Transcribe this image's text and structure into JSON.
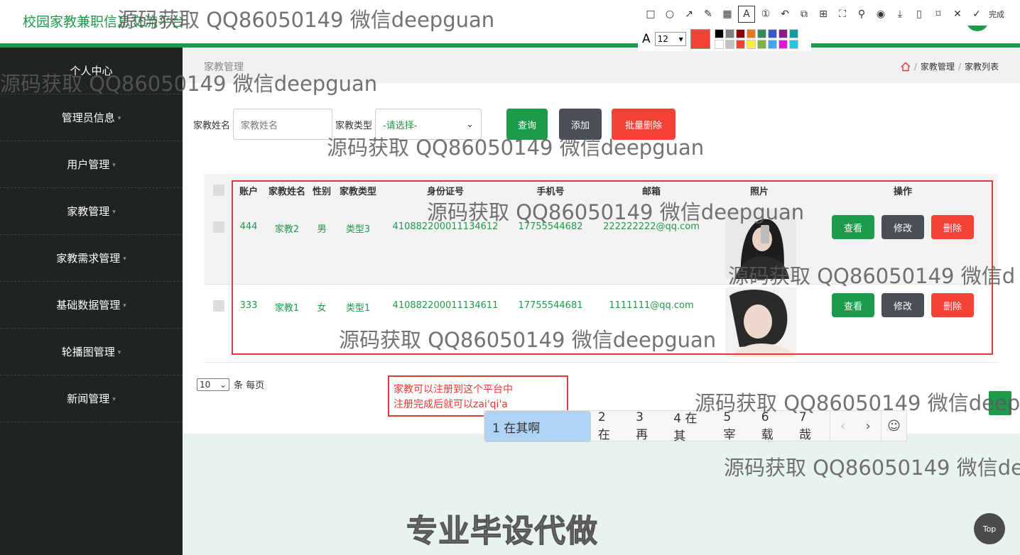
{
  "app": {
    "title": "校园家教兼职信息交流平台"
  },
  "sidebar": {
    "items": [
      {
        "label": "个人中心"
      },
      {
        "label": "管理员信息"
      },
      {
        "label": "用户管理"
      },
      {
        "label": "家教管理"
      },
      {
        "label": "家教需求管理"
      },
      {
        "label": "基础数据管理"
      },
      {
        "label": "轮播图管理"
      },
      {
        "label": "新闻管理"
      }
    ]
  },
  "page": {
    "title": "家教管理",
    "breadcrumb": [
      "家教管理",
      "家教列表"
    ]
  },
  "search": {
    "name_label": "家教姓名",
    "name_placeholder": "家教姓名",
    "type_label": "家教类型",
    "type_selected": "-请选择-",
    "query_button": "查询",
    "add_button": "添加",
    "batch_delete_button": "批量删除"
  },
  "table": {
    "headers": [
      "账户",
      "家教姓名",
      "性别",
      "家教类型",
      "身份证号",
      "手机号",
      "邮箱",
      "照片",
      "操作"
    ],
    "rows": [
      {
        "account": "444",
        "name": "家教2",
        "gender": "男",
        "type": "类型3",
        "id_number": "410882200011134612",
        "phone": "17755544682",
        "email": "222222222@qq.com"
      },
      {
        "account": "333",
        "name": "家教1",
        "gender": "女",
        "type": "类型1",
        "id_number": "410882200011134611",
        "phone": "17755544681",
        "email": "1111111@qq.com"
      }
    ],
    "actions": {
      "view": "查看",
      "edit": "修改",
      "delete": "删除"
    }
  },
  "pagination": {
    "page_size": "10",
    "per_page_label": "条 每页"
  },
  "note": {
    "line1": "家教可以注册到这个平台中",
    "line2": "注册完成后就可以zai'qi'a"
  },
  "ime": {
    "candidates": [
      "1 在其啊",
      "2 在",
      "3 再",
      "4 在其",
      "5 宰",
      "6 载",
      "7 哉"
    ],
    "prev": "‹",
    "next": "›",
    "emoji": "☺"
  },
  "toolbar": {
    "done_label": "完成",
    "font_size": "12",
    "current_color": "#f44336",
    "palette": [
      "#000000",
      "#808080",
      "#8b0000",
      "#e87722",
      "#2e8b57",
      "#3558c8",
      "#8b1a8b",
      "#1a9b9b",
      "#ffffff",
      "#c0c0c0",
      "#f44336",
      "#ffeb3b",
      "#7cb342",
      "#42a5f5",
      "#d81bd8",
      "#26c6da"
    ]
  },
  "overlay": {
    "watermark": "源码获取 QQ86050149 微信deepguan",
    "watermark_cut_1": "源码获取 QQ86050149 微信d",
    "watermark_cut_2": "源码获取 QQ86050149 微信deep",
    "watermark_cut_3": "源码获取 QQ86050149 微信de",
    "banner": "专业毕设代做"
  },
  "top_button": "Top",
  "colors": {
    "brand": "#1e9a4b",
    "danger": "#f44336",
    "dark": "#4a4f57",
    "sidebar": "#1f2321"
  }
}
